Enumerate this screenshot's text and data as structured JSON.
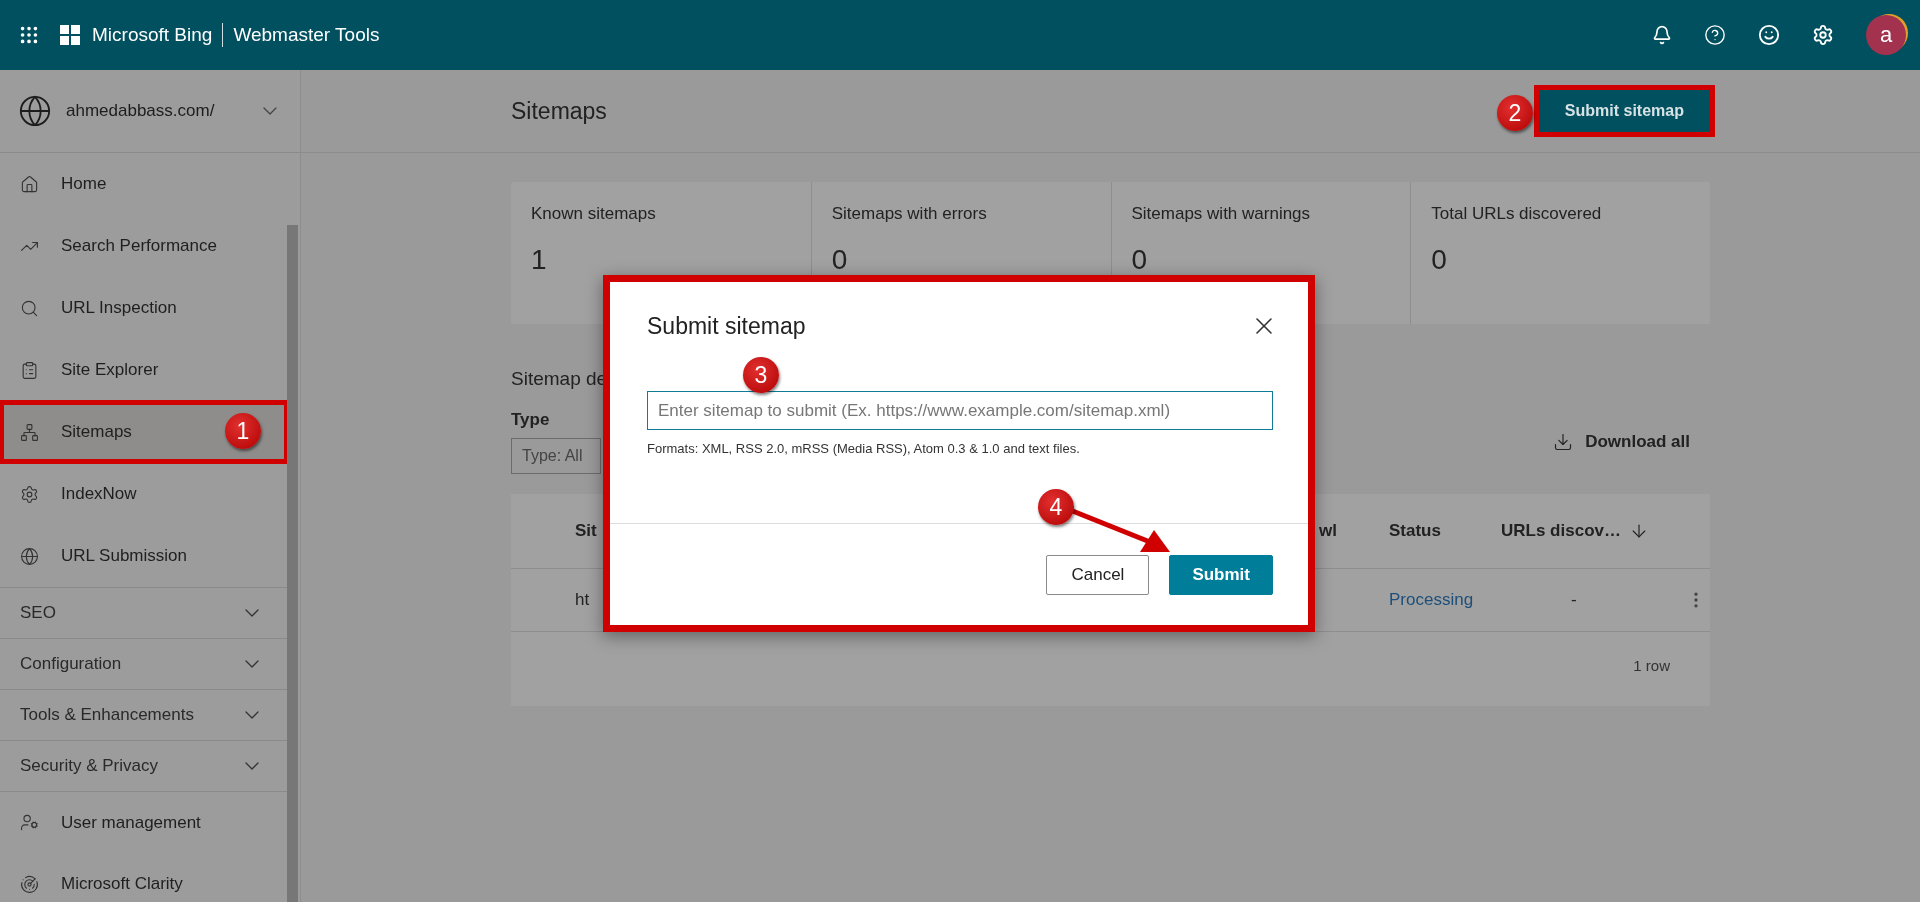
{
  "topbar": {
    "brand": "Microsoft Bing",
    "product": "Webmaster Tools",
    "avatar": "a"
  },
  "site_selector": {
    "value": "ahmedabbass.com/"
  },
  "sidebar": {
    "links": [
      {
        "label": "Home",
        "selected": false,
        "highlighted": false
      },
      {
        "label": "Search Performance",
        "selected": false,
        "highlighted": false
      },
      {
        "label": "URL Inspection",
        "selected": false,
        "highlighted": false
      },
      {
        "label": "Site Explorer",
        "selected": false,
        "highlighted": false
      },
      {
        "label": "Sitemaps",
        "selected": true,
        "highlighted": true
      },
      {
        "label": "IndexNow",
        "selected": false,
        "highlighted": false
      },
      {
        "label": "URL Submission",
        "selected": false,
        "highlighted": false
      }
    ],
    "groups": [
      {
        "label": "SEO",
        "expanded": false
      },
      {
        "label": "Configuration",
        "expanded": false
      },
      {
        "label": "Tools & Enhancements",
        "expanded": false
      },
      {
        "label": "Security & Privacy",
        "expanded": false
      }
    ],
    "bottom_links": [
      {
        "label": "User management"
      },
      {
        "label": "Microsoft Clarity"
      }
    ]
  },
  "page": {
    "title": "Sitemaps",
    "submit_button": {
      "label": "Submit sitemap",
      "highlighted": true
    }
  },
  "stats": [
    {
      "label": "Known sitemaps",
      "value": "1"
    },
    {
      "label": "Sitemaps with errors",
      "value": "0"
    },
    {
      "label": "Sitemaps with warnings",
      "value": "0"
    },
    {
      "label": "Total URLs discovered",
      "value": "0"
    }
  ],
  "details": {
    "heading": "Sitemap de",
    "filter_label": "Type",
    "filter_value": "Type: All",
    "download": "Download all"
  },
  "table": {
    "columns": [
      "Sit",
      "wl",
      "Status",
      "URLs discov…"
    ],
    "rows": [
      {
        "cells": [
          "ht",
          "",
          "Processing",
          "-"
        ]
      }
    ],
    "footer": "1 row"
  },
  "dialog": {
    "title": "Submit sitemap",
    "placeholder": "Enter sitemap to submit (Ex. https://www.example.com/sitemap.xml)",
    "hint": "Formats: XML, RSS 2.0, mRSS (Media RSS), Atom 0.3 & 1.0 and text files.",
    "highlighted": true,
    "buttons": [
      {
        "label": "Cancel",
        "kind": "secondary"
      },
      {
        "label": "Submit",
        "kind": "primary"
      }
    ]
  },
  "annotations": [
    {
      "number": "1"
    },
    {
      "number": "2"
    },
    {
      "number": "3"
    },
    {
      "number": "4"
    }
  ]
}
